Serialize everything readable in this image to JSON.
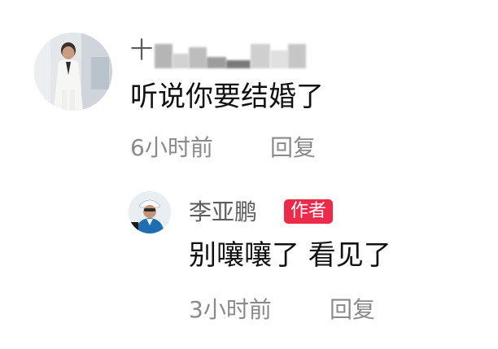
{
  "comment": {
    "username_visible": "十",
    "text": "听说你要结婚了",
    "time": "6小时前",
    "reply_label": "回复"
  },
  "reply": {
    "username": "李亚鹏",
    "author_badge": "作者",
    "text": "别嚷嚷了 看见了",
    "time": "3小时前",
    "reply_label": "回复"
  },
  "colors": {
    "badge": "#ee2a4a",
    "meta_text": "#8a8a8a",
    "username_text": "#5c5c5c",
    "body_text": "#111111"
  }
}
